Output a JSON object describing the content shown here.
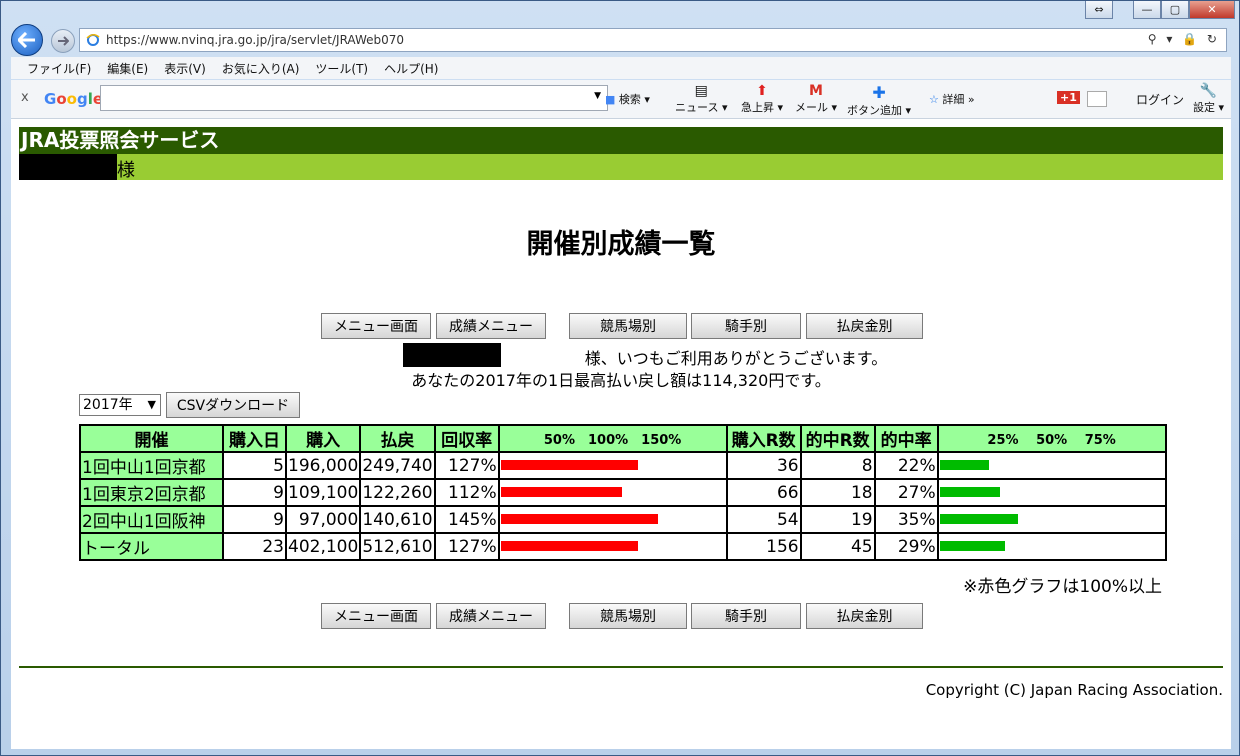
{
  "browser": {
    "url": "https://www.nvinq.jra.go.jp/jra/servlet/JRAWeb070",
    "menu": [
      "ファイル(F)",
      "編集(E)",
      "表示(V)",
      "お気に入り(A)",
      "ツール(T)",
      "ヘルプ(H)"
    ],
    "google": {
      "logo": "Google",
      "search_label": "検索",
      "news": "ニュース",
      "trending": "急上昇",
      "mail": "メール",
      "add_button": "ボタン追加",
      "detail": "詳細 »",
      "login": "ログイン",
      "settings": "設定",
      "gplus": "+1"
    }
  },
  "header": {
    "service_title": "JRA投票照会サービス",
    "honorific": "様"
  },
  "page": {
    "title": "開催別成績一覧",
    "nav_buttons": [
      "メニュー画面",
      "成績メニュー",
      "競馬場別",
      "騎手別",
      "払戻金別"
    ],
    "greeting_suffix": "様、いつもご利用ありがとうございます。",
    "best_payout_msg": "あなたの2017年の1日最高払い戻し額は114,320円です。",
    "year_select": "2017年",
    "csv_button": "CSVダウンロード",
    "note": "※赤色グラフは100%以上",
    "copyright": "Copyright (C) Japan Racing Association."
  },
  "table": {
    "headers": [
      "開催",
      "購入日",
      "購入",
      "払戻",
      "回収率",
      "50%　100%　150%",
      "購入R数",
      "的中R数",
      "的中率",
      "25%　 50%　 75%"
    ],
    "rows": [
      {
        "name": "1回中山1回京都",
        "days": "5",
        "bought": "196,000",
        "payout": "249,740",
        "return_rate": "127%",
        "return_value": 127,
        "races": "36",
        "hits": "8",
        "hit_rate": "22%",
        "hit_value": 22
      },
      {
        "name": "1回東京2回京都",
        "days": "9",
        "bought": "109,100",
        "payout": "122,260",
        "return_rate": "112%",
        "return_value": 112,
        "races": "66",
        "hits": "18",
        "hit_rate": "27%",
        "hit_value": 27
      },
      {
        "name": "2回中山1回阪神",
        "days": "9",
        "bought": " 97,000",
        "payout": "140,610",
        "return_rate": "145%",
        "return_value": 145,
        "races": "54",
        "hits": "19",
        "hit_rate": "35%",
        "hit_value": 35
      },
      {
        "name": "トータル",
        "days": "23",
        "bought": "402,100",
        "payout": "512,610",
        "return_rate": "127%",
        "return_value": 127,
        "races": "156",
        "hits": "45",
        "hit_rate": "29%",
        "hit_value": 29
      }
    ]
  },
  "colors": {
    "header_dark": "#2a5a00",
    "header_light": "#99cc33",
    "table_header": "#99ff99",
    "bar_return": "#ff0000",
    "bar_hit": "#00bb00"
  }
}
